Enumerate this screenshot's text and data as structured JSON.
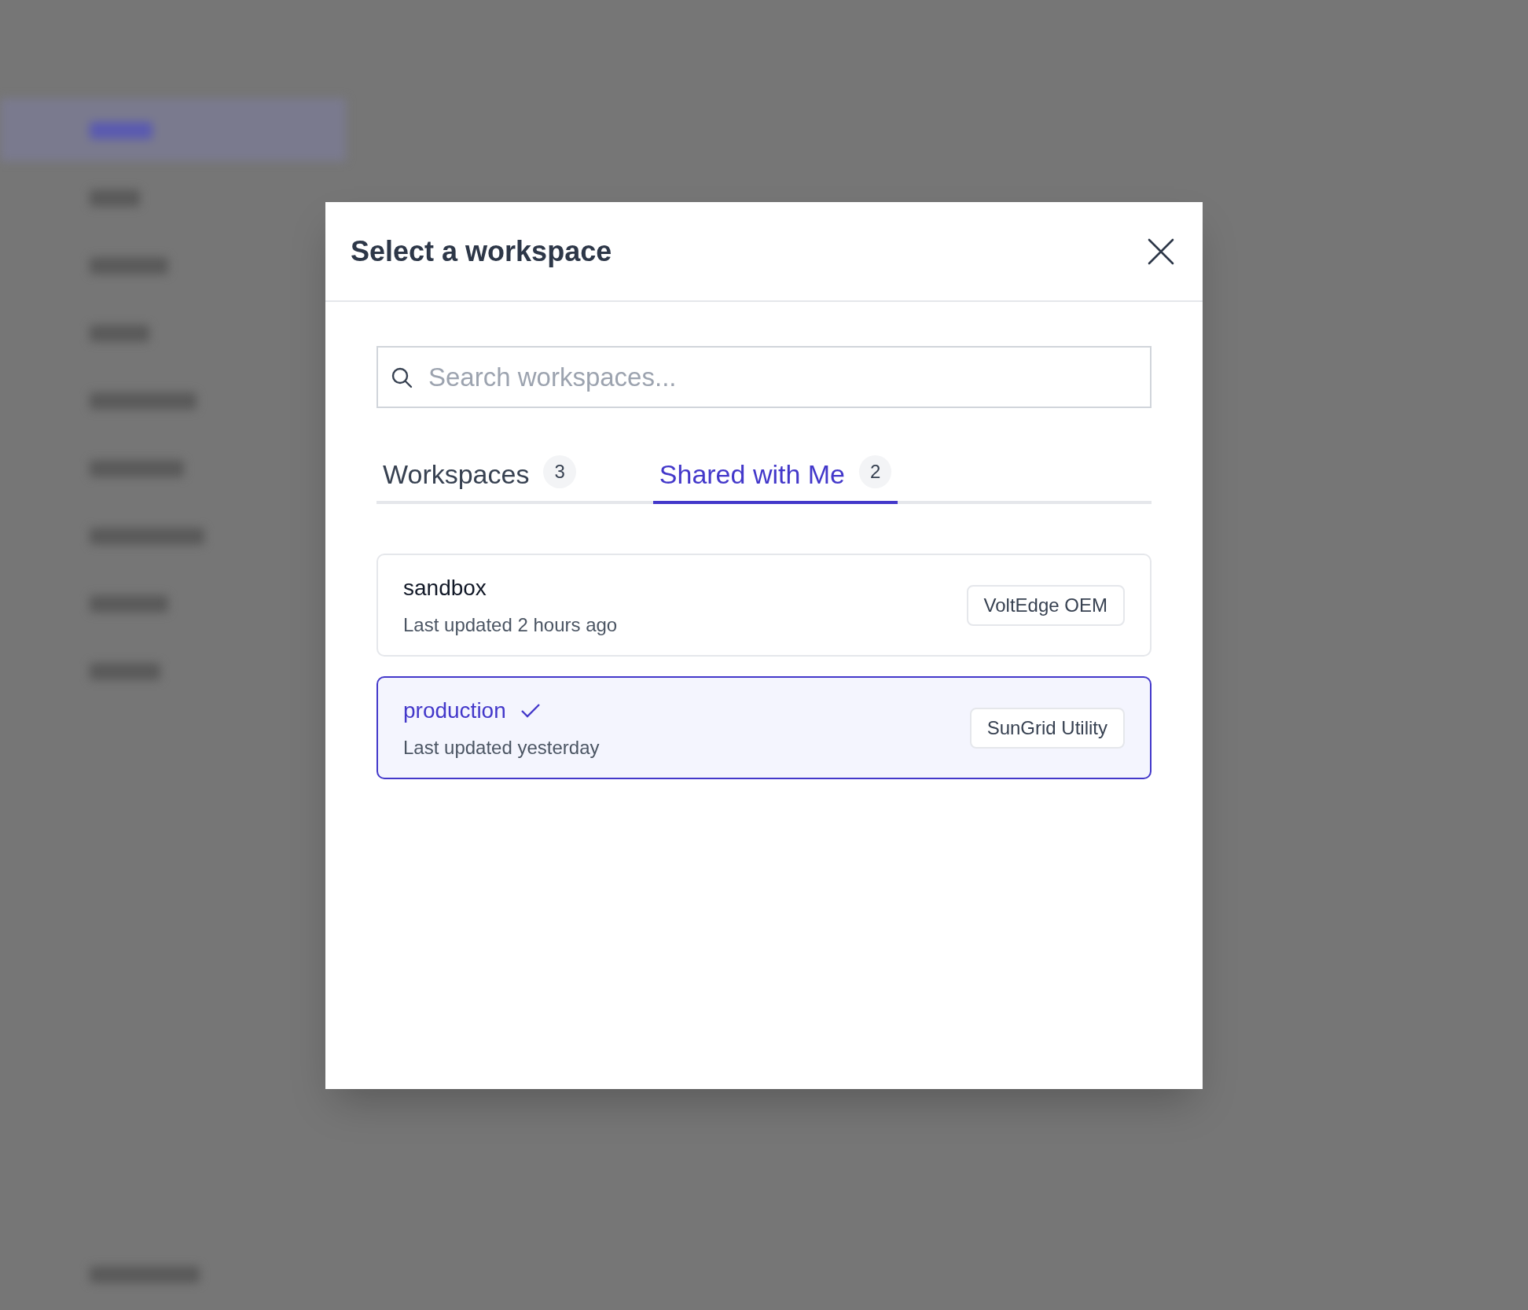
{
  "dialog": {
    "title": "Select a workspace"
  },
  "search": {
    "placeholder": "Search workspaces..."
  },
  "tabs": [
    {
      "label": "Workspaces",
      "count": "3",
      "selected": false
    },
    {
      "label": "Shared with Me",
      "count": "2",
      "selected": true
    }
  ],
  "workspaces": [
    {
      "name": "sandbox",
      "updated": "Last updated 2 hours ago",
      "organization": "VoltEdge OEM",
      "selected": false
    },
    {
      "name": "production",
      "updated": "Last updated yesterday",
      "organization": "SunGrid Utility",
      "selected": true
    }
  ]
}
